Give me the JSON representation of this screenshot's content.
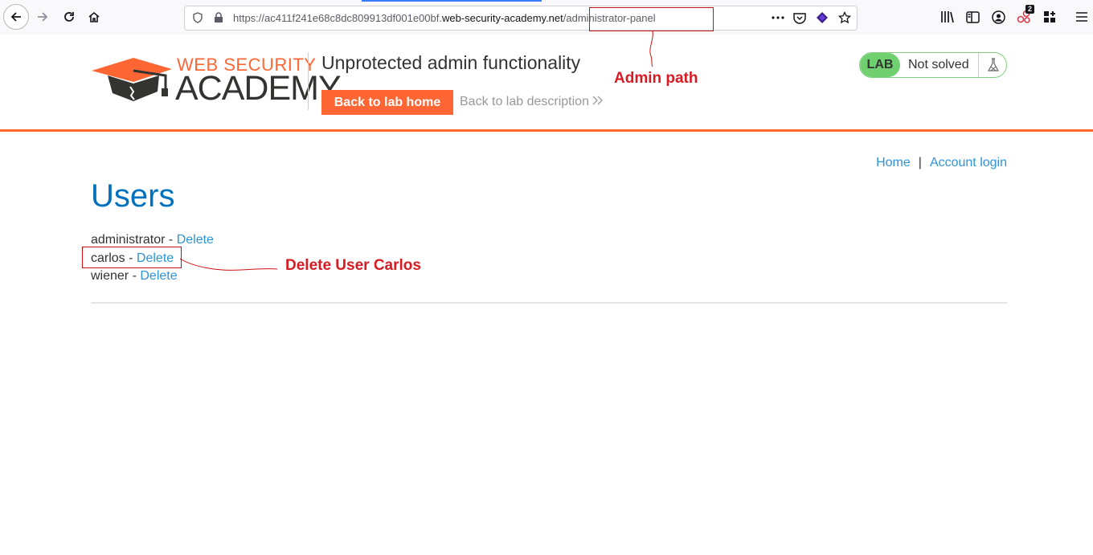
{
  "browser": {
    "url_prefix": "https://ac411f241e68c8dc809913df001e00bf.",
    "url_host": "web-security-academy.net",
    "url_path": "/administrator-panel",
    "notification_count": "2"
  },
  "header": {
    "logo_top": "WEB SECURITY",
    "logo_main": "ACADEMY",
    "lab_title": "Unprotected admin functionality",
    "back_home_label": "Back to lab home",
    "back_desc_label": "Back to lab description",
    "lab_badge": "LAB",
    "lab_status": "Not solved"
  },
  "nav": {
    "home": "Home",
    "separator": "|",
    "account_login": "Account login"
  },
  "main": {
    "title": "Users",
    "users": [
      {
        "name": "administrator",
        "sep": " - ",
        "action": "Delete"
      },
      {
        "name": "carlos",
        "sep": " - ",
        "action": "Delete"
      },
      {
        "name": "wiener",
        "sep": " - ",
        "action": "Delete"
      }
    ]
  },
  "annotations": {
    "admin_path": "Admin path",
    "delete_carlos": "Delete User Carlos",
    "color": "#d61b23"
  },
  "colors": {
    "accent": "#ff6633",
    "link": "#2d95d6",
    "title": "#0071bc",
    "lab_green": "#70d070"
  }
}
